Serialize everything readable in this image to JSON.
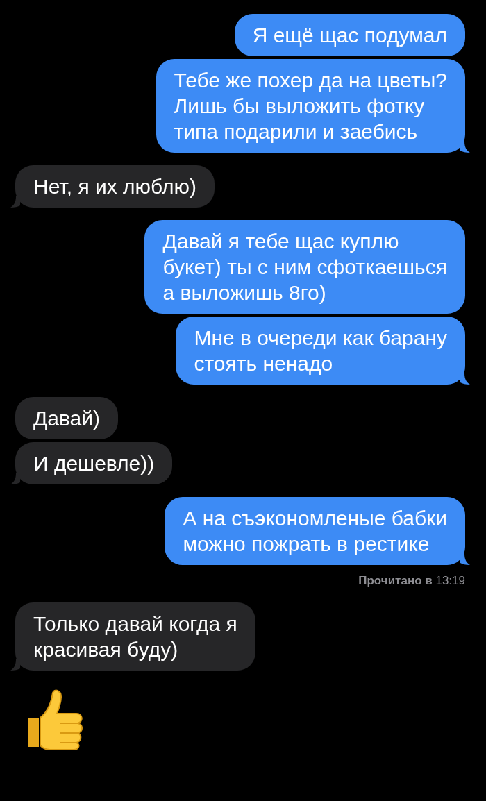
{
  "messages": [
    {
      "kind": "sent",
      "text": "Я ещё щас подумал",
      "tail": false
    },
    {
      "kind": "sent",
      "text": "Тебе же похер да на цветы?\nЛишь бы выложить фотку\nтипа подарили и заебись",
      "tail": true
    },
    {
      "kind": "received",
      "text": "Нет, я их люблю)",
      "tail": true
    },
    {
      "kind": "sent",
      "text": "Давай я тебе щас куплю\nбукет) ты с ним сфоткаешься\nа выложишь 8го)",
      "tail": false
    },
    {
      "kind": "sent",
      "text": "Мне в очереди как барану\nстоять ненадо",
      "tail": true
    },
    {
      "kind": "received",
      "text": "Давай)",
      "tail": false
    },
    {
      "kind": "received",
      "text": "И дешевле))",
      "tail": true
    },
    {
      "kind": "sent",
      "text": "А на съэкономленые бабки\nможно пожрать в рестике",
      "tail": true
    }
  ],
  "read_receipt": "**Прочитано в** 13:19",
  "messages_after": [
    {
      "kind": "received",
      "text": "Только давай когда я\nкрасивая буду)",
      "tail": true
    }
  ],
  "reaction": {
    "kind": "thumbs_up"
  }
}
